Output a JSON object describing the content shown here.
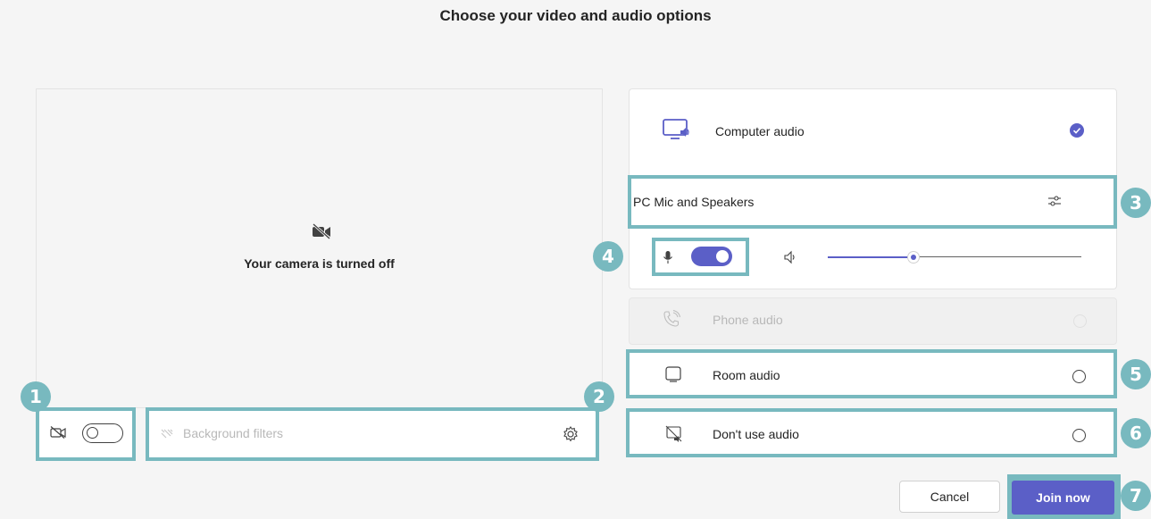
{
  "header": {
    "title": "Choose your video and audio options"
  },
  "preview": {
    "camera_status": "Your camera is turned off",
    "camera_toggle_on": false,
    "background_filters_label": "Background filters"
  },
  "audio": {
    "options": [
      {
        "label": "Computer audio",
        "selected": true,
        "icon": "computer-audio-icon"
      },
      {
        "label": "Phone audio",
        "selected": false,
        "disabled": true,
        "icon": "phone-icon"
      },
      {
        "label": "Room audio",
        "selected": false,
        "icon": "room-audio-icon"
      },
      {
        "label": "Don't use audio",
        "selected": false,
        "icon": "no-audio-icon"
      }
    ],
    "device_label": "PC Mic and Speakers",
    "mic_toggle_on": true,
    "speaker_volume": 0.33
  },
  "buttons": {
    "cancel": "Cancel",
    "join": "Join now"
  },
  "callouts": [
    "1",
    "2",
    "3",
    "4",
    "5",
    "6",
    "7"
  ],
  "colors": {
    "accent": "#5b5fc7",
    "callout": "#78b9bf"
  }
}
